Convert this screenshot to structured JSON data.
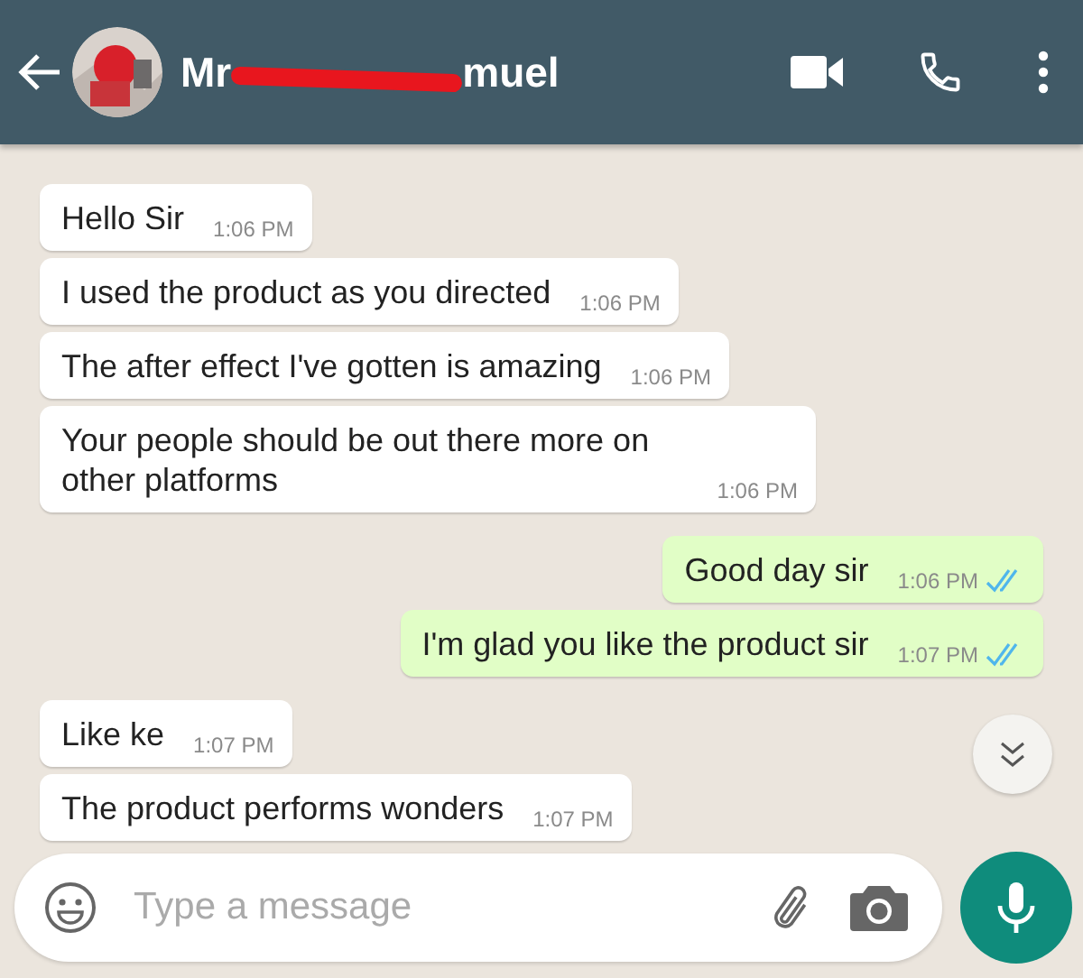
{
  "header": {
    "title_start": "Mr",
    "title_end": "muel",
    "redacted": true
  },
  "messages": [
    {
      "kind": "in",
      "text": "Hello Sir",
      "time": "1:06 PM"
    },
    {
      "kind": "in",
      "text": "I used the product as you directed",
      "time": "1:06 PM"
    },
    {
      "kind": "in",
      "text": "The after effect I've gotten is amazing",
      "time": "1:06 PM"
    },
    {
      "kind": "in",
      "text": "Your people should be out there more on other platforms",
      "time": "1:06 PM"
    },
    {
      "kind": "out",
      "text": "Good day sir",
      "time": "1:06 PM",
      "read": true
    },
    {
      "kind": "out",
      "text": "I'm glad you like the product sir",
      "time": "1:07 PM",
      "read": true
    },
    {
      "kind": "in",
      "text": "Like ke",
      "time": "1:07 PM"
    },
    {
      "kind": "in",
      "text": "The product performs wonders",
      "time": "1:07 PM"
    }
  ],
  "composer": {
    "placeholder": "Type a message"
  }
}
